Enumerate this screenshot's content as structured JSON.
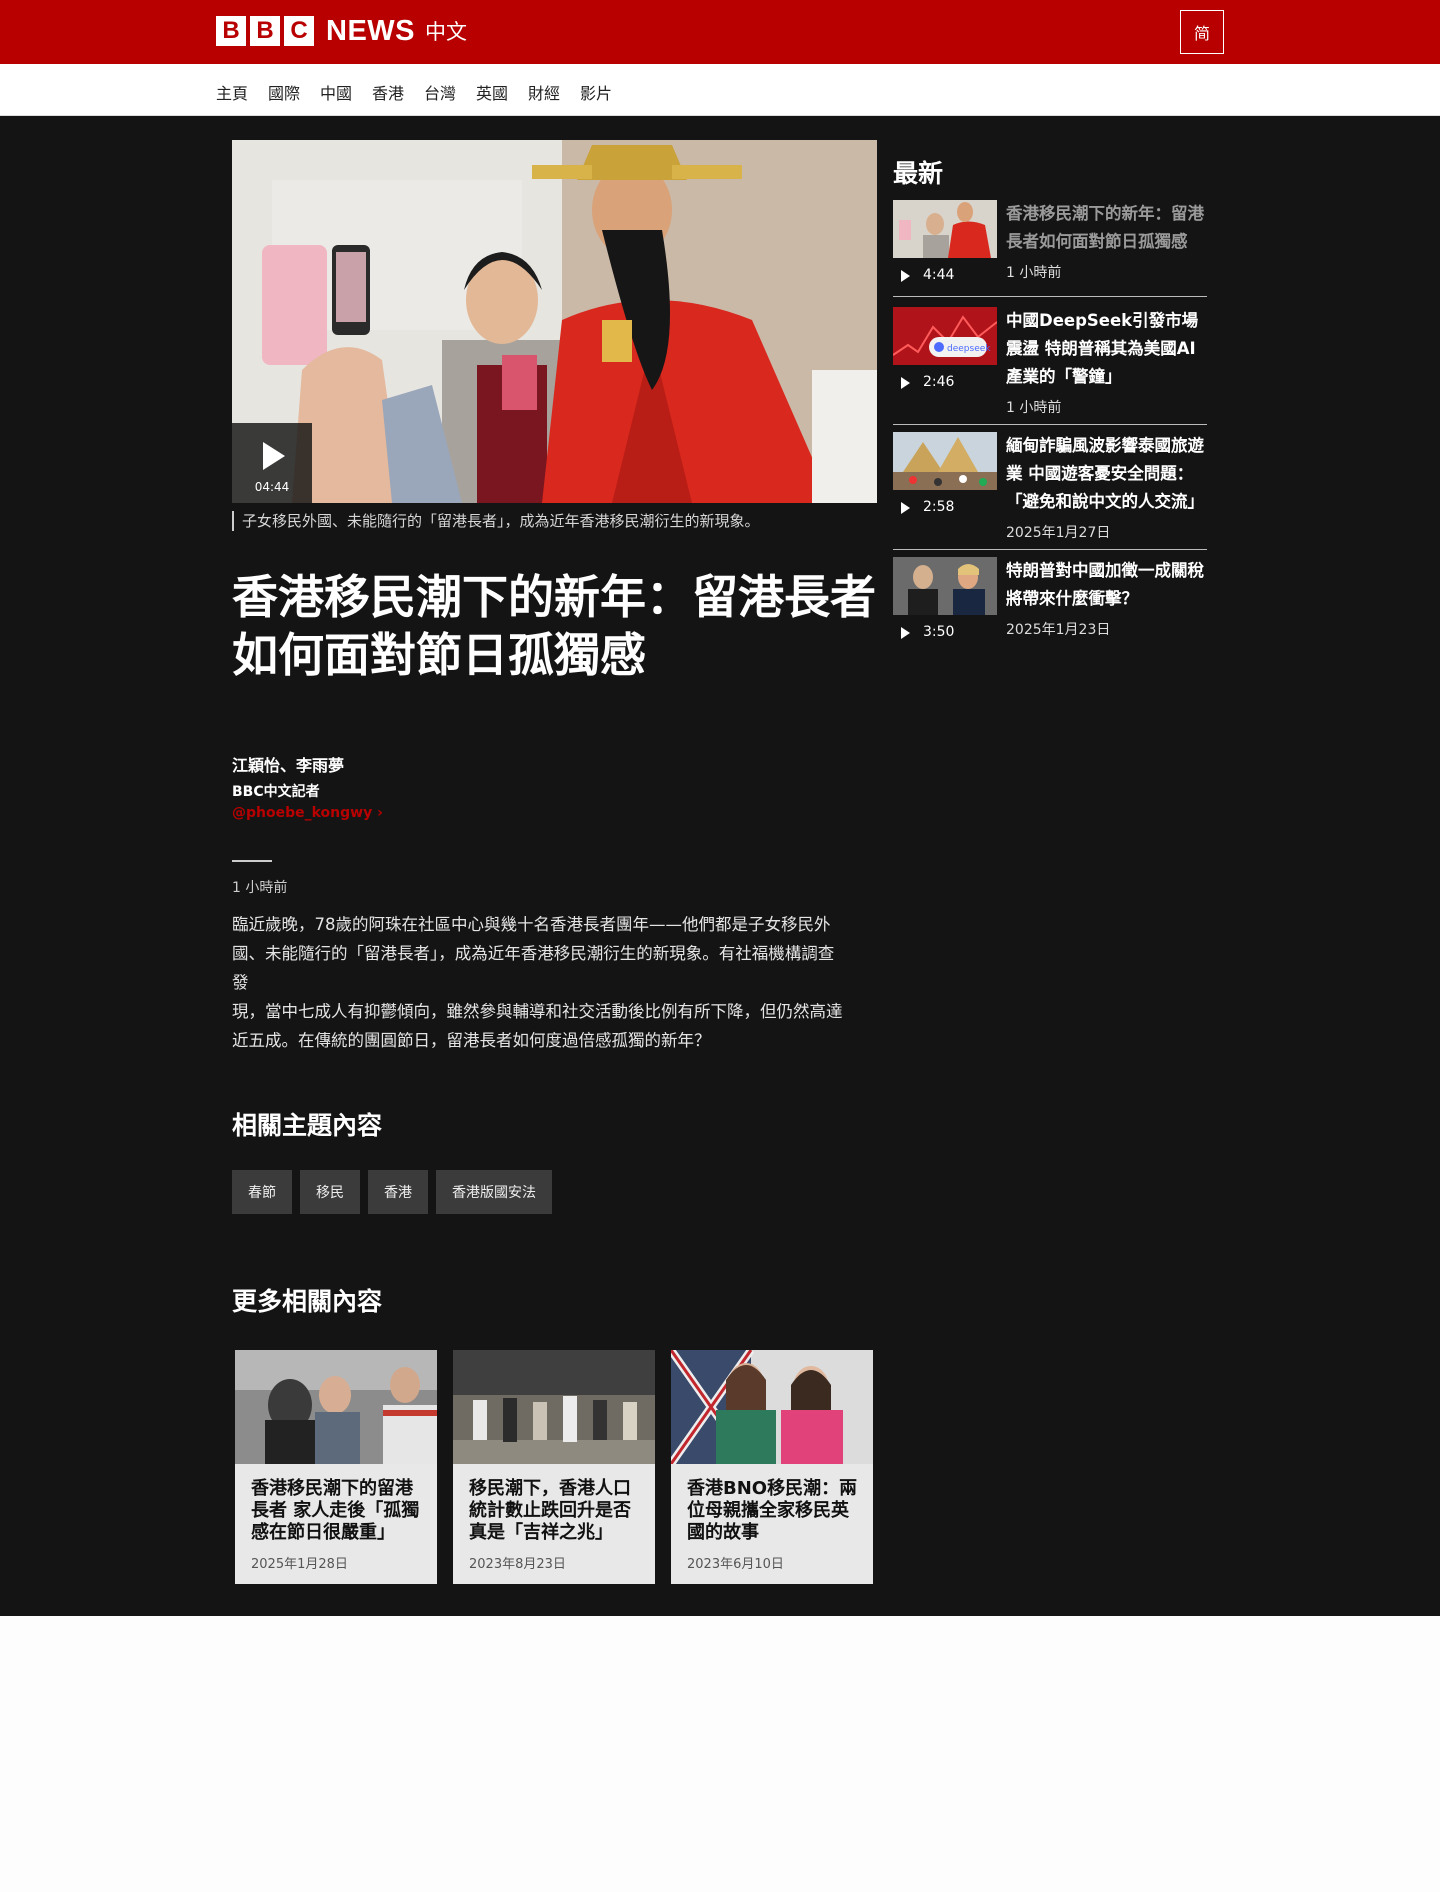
{
  "header": {
    "logo_letters": [
      "B",
      "B",
      "C"
    ],
    "logo_news": "NEWS",
    "logo_lang": "中文",
    "lang_toggle": "简"
  },
  "nav": {
    "items": [
      "主頁",
      "國際",
      "中國",
      "香港",
      "台灣",
      "英國",
      "財經",
      "影片"
    ]
  },
  "hero": {
    "video_duration": "04:44",
    "caption": "子女移民外國、未能隨行的「留港長者」，成為近年香港移民潮衍生的新現象。"
  },
  "article": {
    "headline_line1": "香港移民潮下的新年：留港長者",
    "headline_line2": "如何面對節日孤獨感",
    "author": "江穎怡、李雨夢",
    "role": "BBC中文記者",
    "handle": "@phoebe_kongwy",
    "published": "1 小時前",
    "body": [
      "臨近歲晚，78歲的阿珠在社區中心與幾十名香港長者團年——他們都是子女移民外",
      "國、未能隨行的「留港長者」，成為近年香港移民潮衍生的新現象。有社福機構調查發",
      "現，當中七成人有抑鬱傾向，雖然參與輔導和社交活動後比例有所下降，但仍然高達",
      "近五成。在傳統的團圓節日，留港長者如何度過倍感孤獨的新年？"
    ]
  },
  "topics": {
    "title": "相關主題內容",
    "tags": [
      "春節",
      "移民",
      "香港",
      "香港版國安法"
    ]
  },
  "more": {
    "title": "更多相關內容",
    "cards": [
      {
        "title": "香港移民潮下的留港長者 家人走後「孤獨感在節日很嚴重」",
        "date": "2025年1月28日"
      },
      {
        "title": "移民潮下，香港人口統計數止跌回升是否真是「吉祥之兆」",
        "date": "2023年8月23日"
      },
      {
        "title": "香港BNO移民潮：兩位母親攜全家移民英國的故事",
        "date": "2023年6月10日"
      }
    ]
  },
  "sidebar": {
    "title": "最新",
    "items": [
      {
        "title": "香港移民潮下的新年：留港長者如何面對節日孤獨感",
        "duration": "4:44",
        "time": "1 小時前"
      },
      {
        "title": "中國DeepSeek引發市場震盪 特朗普稱其為美國AI產業的「警鐘」",
        "duration": "2:46",
        "time": "1 小時前"
      },
      {
        "title": "緬甸詐騙風波影響泰國旅遊業 中國遊客憂安全問題：「避免和說中文的人交流」",
        "duration": "2:58",
        "time": "2025年1月27日"
      },
      {
        "title": "特朗普對中國加徵一成關稅將帶來什麼衝擊？",
        "duration": "3:50",
        "time": "2025年1月23日"
      }
    ]
  },
  "colors": {
    "brand_red": "#b80000",
    "dark_bg": "#141414"
  }
}
